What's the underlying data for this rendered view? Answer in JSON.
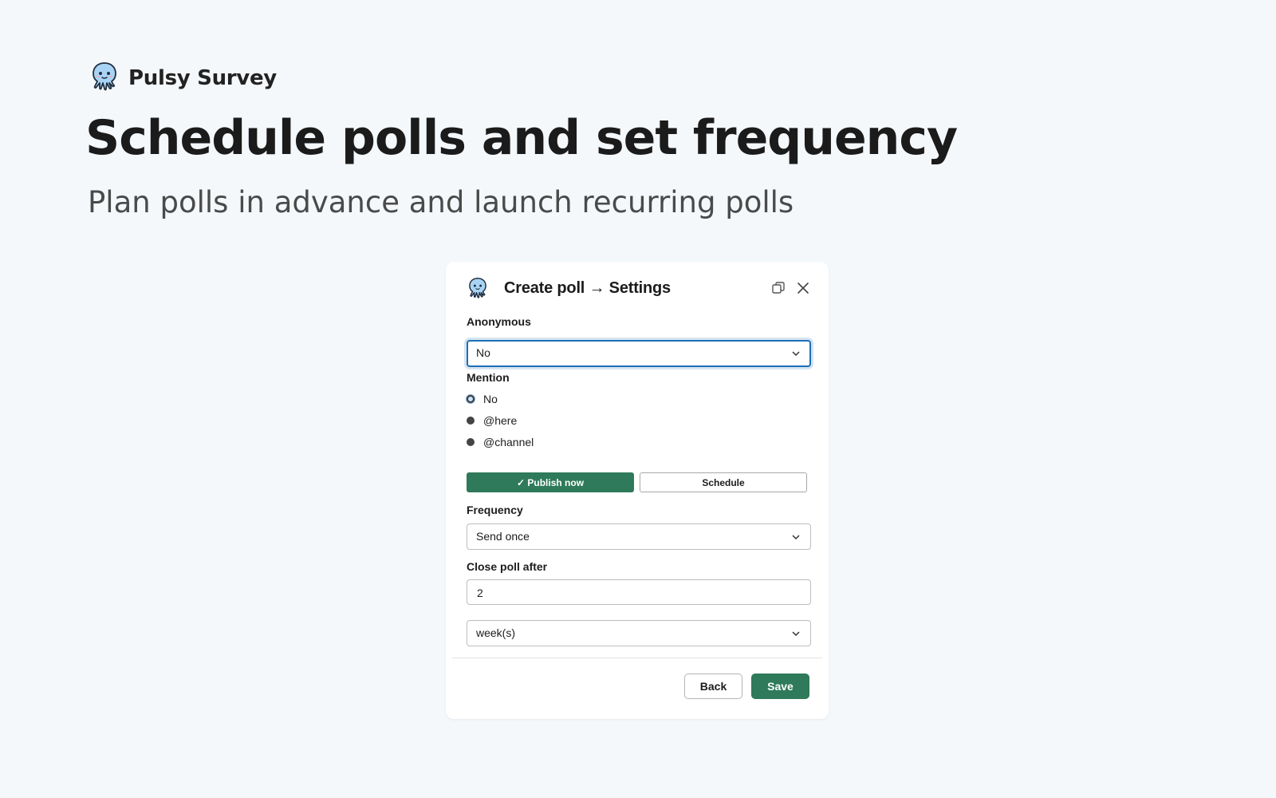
{
  "brand": {
    "name": "Pulsy Survey",
    "logo_icon": "octopus-icon"
  },
  "headline": "Schedule polls and set frequency",
  "subheadline": "Plan polls in advance and launch recurring polls",
  "modal": {
    "title": "Create poll → Settings",
    "header_icons": [
      "restore-window-icon",
      "close-icon"
    ],
    "anonymous": {
      "label": "Anonymous",
      "value": "No"
    },
    "mention": {
      "label": "Mention",
      "selected": "No",
      "options": [
        {
          "label": "No"
        },
        {
          "label": "@here"
        },
        {
          "label": "@channel"
        }
      ]
    },
    "publish_toggle": {
      "publish_now": "✓ Publish now",
      "schedule": "Schedule",
      "active": "publish_now"
    },
    "frequency": {
      "label": "Frequency",
      "value": "Send once"
    },
    "close_after": {
      "label": "Close poll after",
      "value": "2",
      "unit": "week(s)"
    },
    "footer": {
      "back": "Back",
      "save": "Save"
    }
  },
  "colors": {
    "page_bg": "#f4f8fb",
    "accent_green": "#2e7a5a",
    "focus_blue": "#1d6fb5"
  }
}
